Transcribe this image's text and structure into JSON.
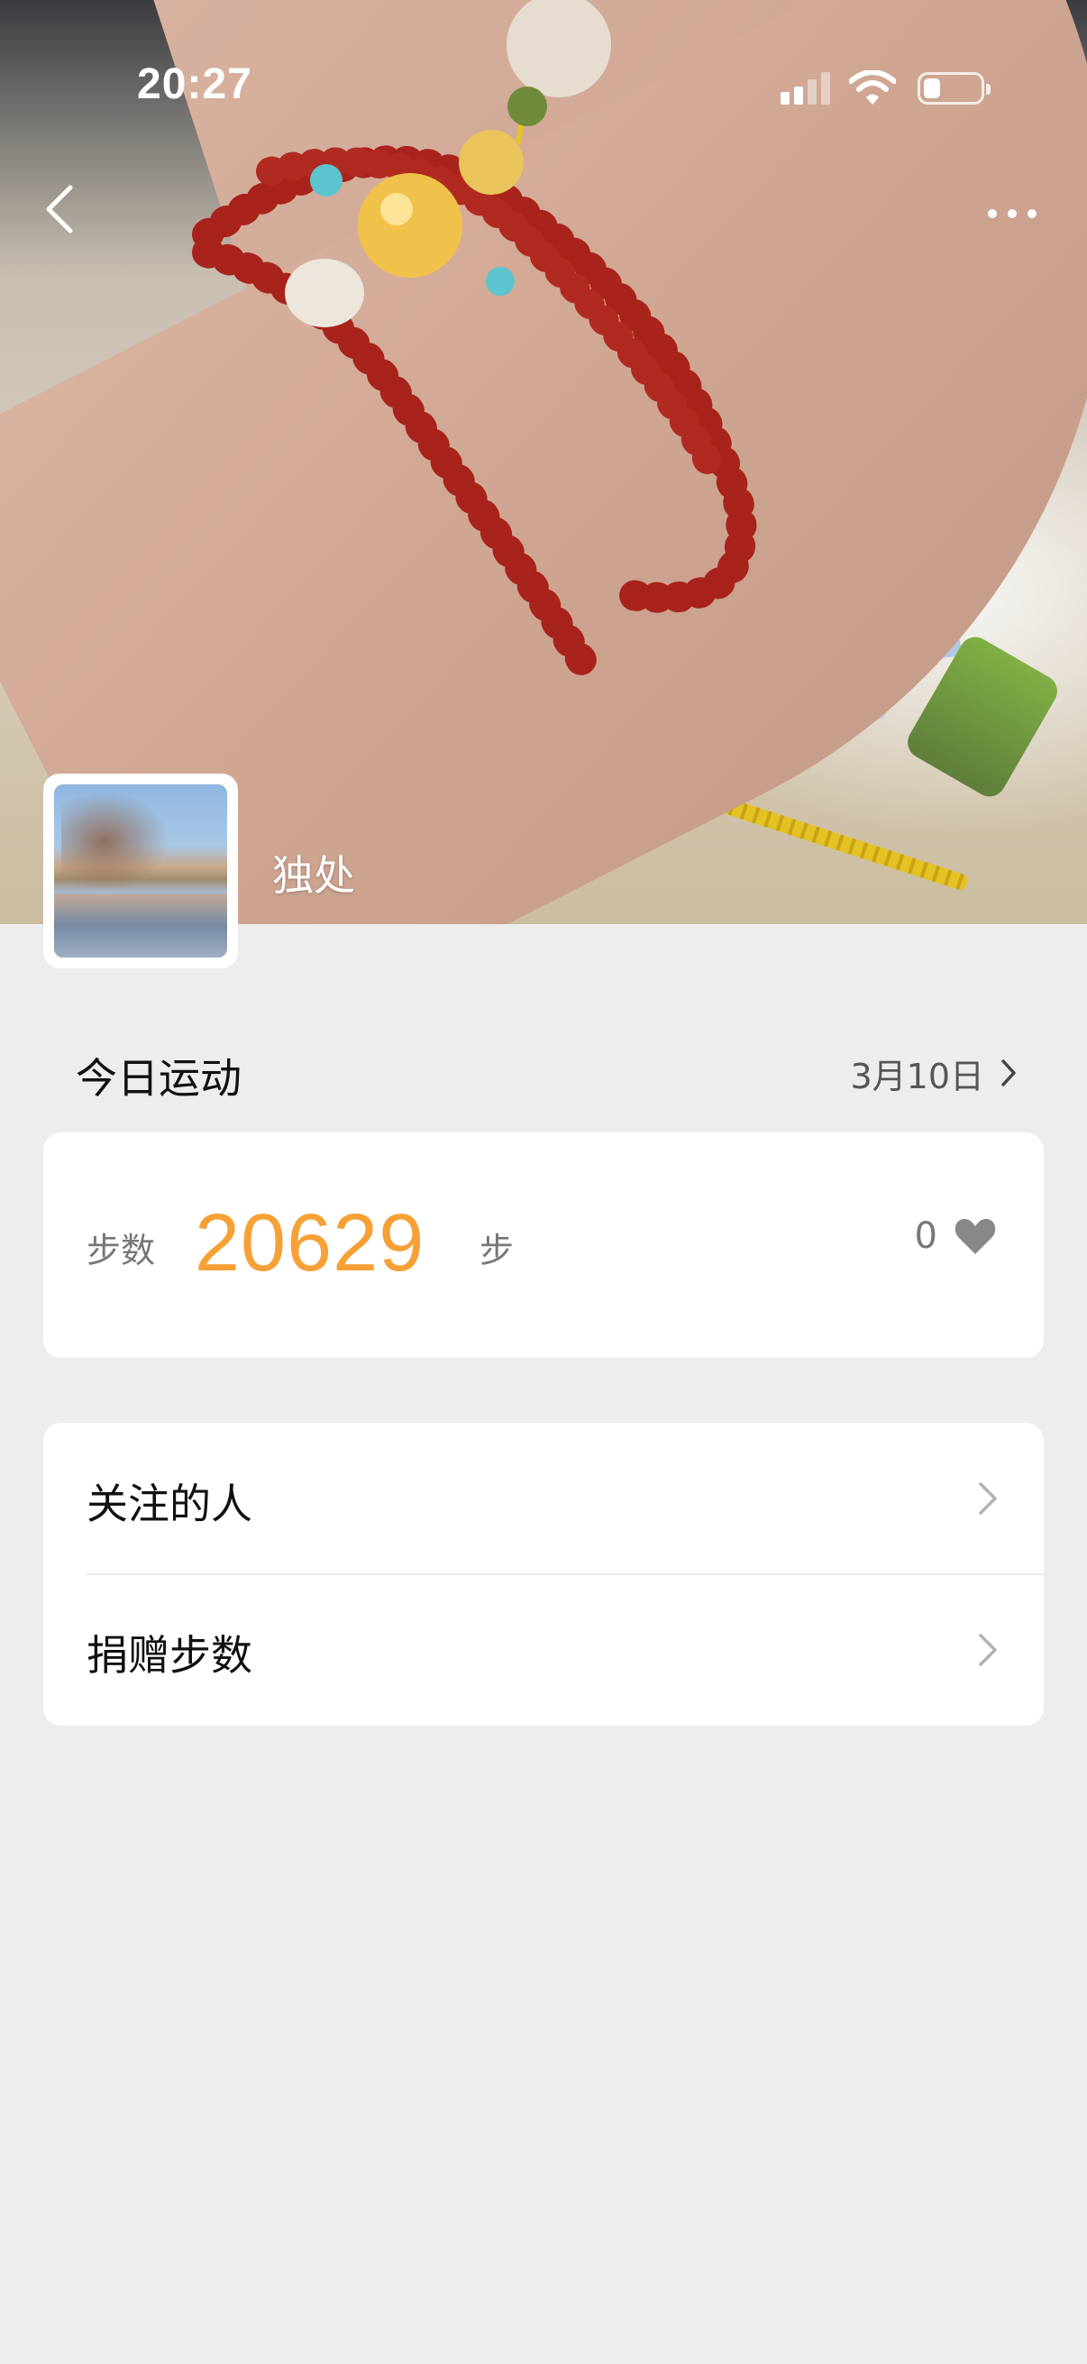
{
  "status_bar": {
    "time": "20:27",
    "battery_level": 0.3
  },
  "nav": {
    "back_icon": "chevron-left-icon",
    "more_icon": "more-dots-icon"
  },
  "profile": {
    "username": "独处"
  },
  "today": {
    "title": "今日运动",
    "date": "3月10日",
    "steps_label": "步数",
    "steps_value": "20629",
    "steps_unit": "步",
    "likes_count": "0"
  },
  "menu": {
    "items": [
      {
        "label": "关注的人"
      },
      {
        "label": "捐赠步数"
      }
    ]
  },
  "colors": {
    "accent": "#f6a036",
    "background": "#ededed",
    "card": "#ffffff"
  }
}
